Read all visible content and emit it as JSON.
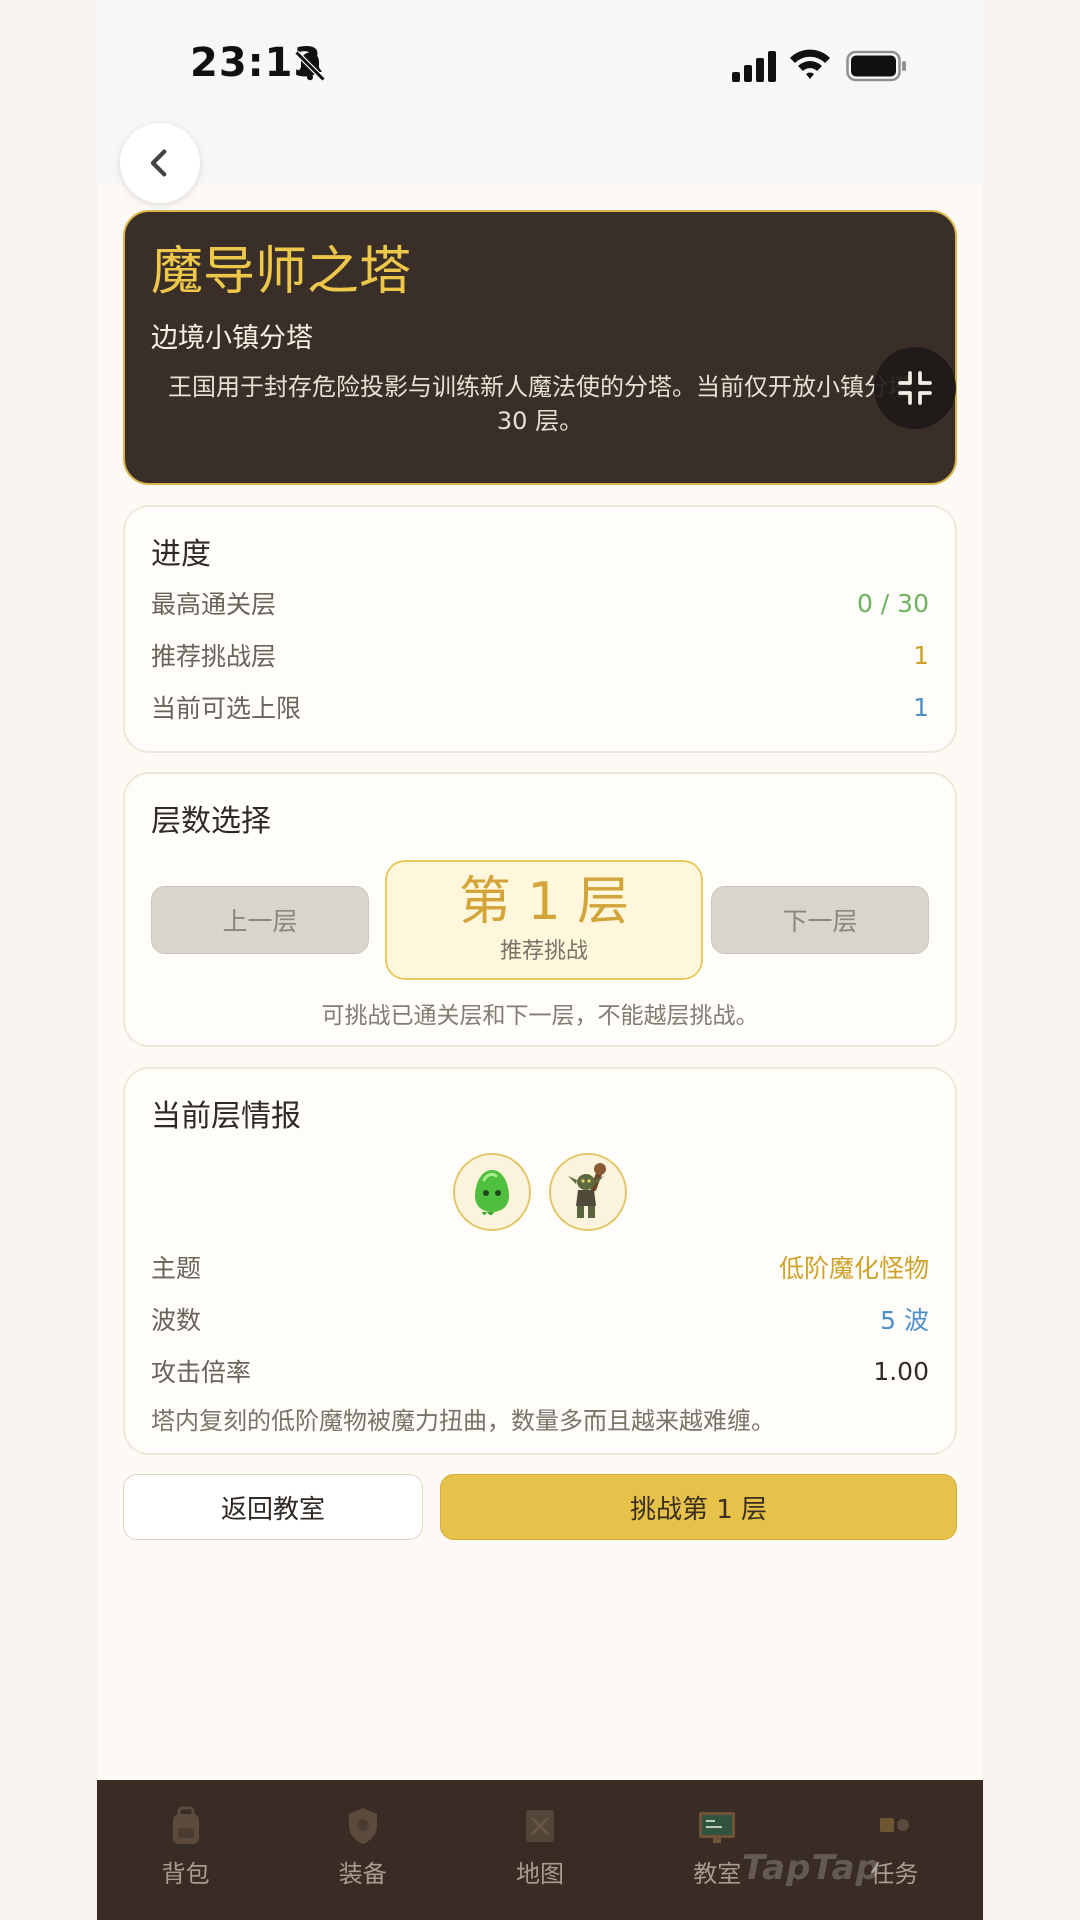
{
  "status_bar": {
    "time": "23:13",
    "icons": [
      "bell-slash-icon",
      "signal-icon",
      "wifi-icon",
      "battery-icon"
    ]
  },
  "header": {
    "back_icon": "chevron-left-icon"
  },
  "hero": {
    "title": "魔导师之塔",
    "subtitle": "边境小镇分塔",
    "description": "王国用于封存危险投影与训练新人魔法使的分塔。当前仅开放小镇分塔 30 层。",
    "collapse_icon": "collapse-icon"
  },
  "progress": {
    "title": "进度",
    "rows": [
      {
        "label": "最高通关层",
        "value": "0 / 30"
      },
      {
        "label": "推荐挑战层",
        "value": "1"
      },
      {
        "label": "当前可选上限",
        "value": "1"
      }
    ]
  },
  "floor_select": {
    "title": "层数选择",
    "prev_label": "上一层",
    "next_label": "下一层",
    "current": "第 1 层",
    "current_tag": "推荐挑战",
    "hint": "可挑战已通关层和下一层，不能越层挑战。"
  },
  "intel": {
    "title": "当前层情报",
    "monsters": [
      "slime-icon",
      "goblin-icon"
    ],
    "rows": [
      {
        "label": "主题",
        "value": "低阶魔化怪物"
      },
      {
        "label": "波数",
        "value": "5 波"
      },
      {
        "label": "攻击倍率",
        "value": "1.00"
      }
    ],
    "description": "塔内复刻的低阶魔物被魔力扭曲，数量多而且越来越难缠。"
  },
  "actions": {
    "return_label": "返回教室",
    "challenge_label": "挑战第 1 层"
  },
  "nav": {
    "items": [
      {
        "label": "背包",
        "icon": "backpack-icon"
      },
      {
        "label": "装备",
        "icon": "equipment-icon"
      },
      {
        "label": "地图",
        "icon": "map-icon"
      },
      {
        "label": "教室",
        "icon": "classroom-icon"
      },
      {
        "label": "任务",
        "icon": "quest-icon"
      }
    ]
  },
  "watermark": "TapTap",
  "colors": {
    "hero_bg": "#3a2f28",
    "gold": "#ecc74a",
    "accent_button": "#e7c24b",
    "green_value": "#6bb35c",
    "blue_value": "#4f90c9",
    "nav_bg": "#382c24"
  }
}
